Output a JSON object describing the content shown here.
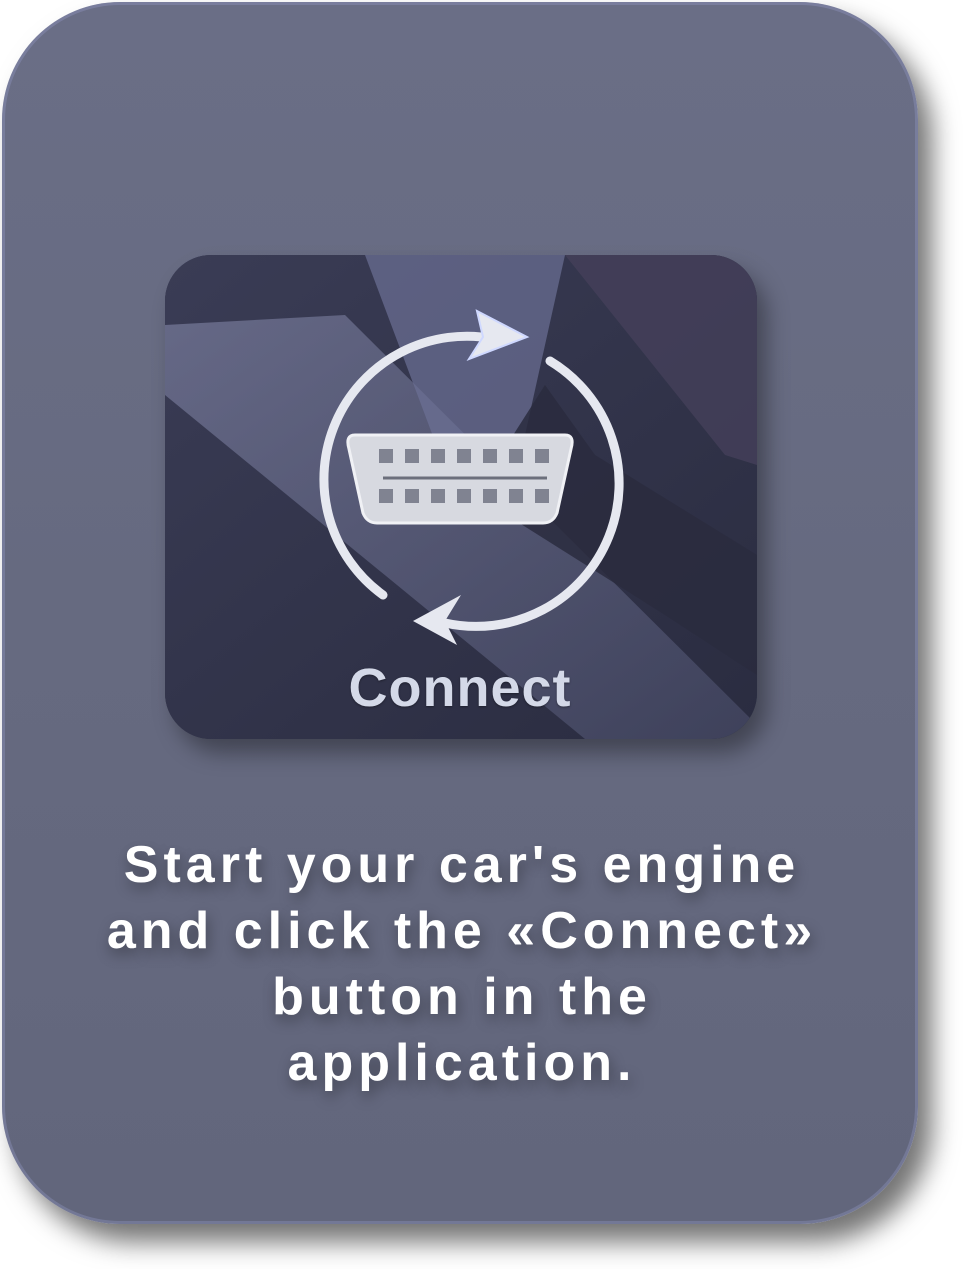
{
  "card": {
    "button_label": "Connect",
    "instruction_lines": [
      "Start your car's engine",
      "and click the «Connect»",
      "button in the",
      "application."
    ]
  },
  "icons": {
    "connect_icon": "obd-connector-with-sync-arrows-icon"
  },
  "colors": {
    "card_background": "#686c83",
    "tile_background": "#2e3046",
    "arrow_color": "#e6e8f0",
    "arrow_accent": "#cfd8ff",
    "text_color": "#ffffff"
  }
}
